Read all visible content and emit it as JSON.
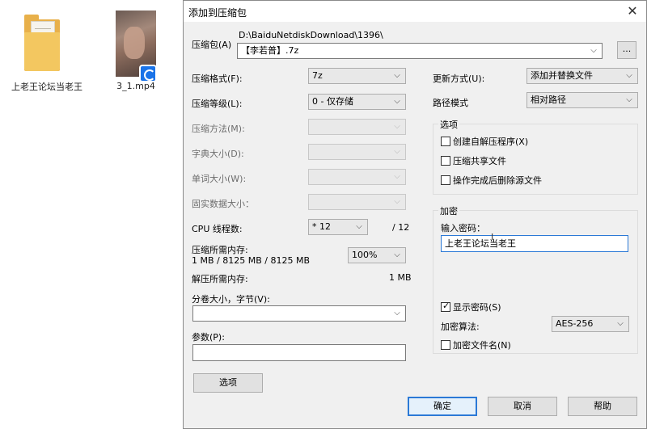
{
  "desktop": {
    "folder_label": "上老王论坛当老王",
    "video_label": "3_1.mp4"
  },
  "dialog": {
    "title": "添加到压缩包",
    "archive": {
      "label": "压缩包(A)",
      "path": "D:\\BaiduNetdiskDownload\\1396\\",
      "name": "【李若普】.7z",
      "browse_label": "..."
    },
    "left": {
      "format_label": "压缩格式(F):",
      "format_value": "7z",
      "level_label": "压缩等级(L):",
      "level_value": "0 - 仅存储",
      "method_label": "压缩方法(M):",
      "dict_label": "字典大小(D):",
      "word_label": "单词大小(W):",
      "solid_label": "固实数据大小：",
      "threads_label": "CPU 线程数:",
      "threads_value": "* 12",
      "threads_total": "/ 12",
      "mem_comp_label": "压缩所需内存:",
      "mem_comp_value": "1 MB / 8125 MB / 8125 MB",
      "mem_percent": "100%",
      "mem_decomp_label": "解压所需内存:",
      "mem_decomp_value": "1 MB",
      "volume_label": "分卷大小，字节(V):",
      "volume_value": "",
      "params_label": "参数(P):",
      "params_value": "",
      "options_button": "选项"
    },
    "right": {
      "update_label": "更新方式(U):",
      "update_value": "添加并替换文件",
      "pathmode_label": "路径模式",
      "pathmode_value": "相对路径",
      "options_group": "选项",
      "opt_sfx": "创建自解压程序(X)",
      "opt_shared": "压缩共享文件",
      "opt_delete": "操作完成后删除源文件",
      "encrypt_group": "加密",
      "password_label": "输入密码：",
      "password_value": "上老王论坛当老王",
      "show_password": "显示密码(S)",
      "method_label": "加密算法:",
      "method_value": "AES-256",
      "encrypt_names": "加密文件名(N)"
    },
    "buttons": {
      "ok": "确定",
      "cancel": "取消",
      "help": "帮助"
    }
  }
}
